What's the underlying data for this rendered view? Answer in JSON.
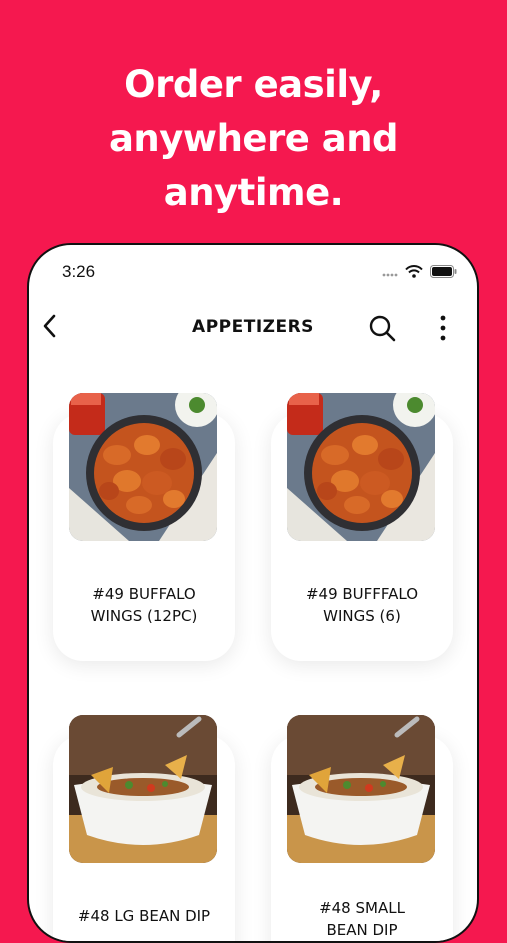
{
  "promo": {
    "headline_lines": [
      "Order easily,",
      "anywhere and",
      "anytime."
    ]
  },
  "status_bar": {
    "time": "3:26"
  },
  "nav": {
    "title": "APPETIZERS"
  },
  "items": [
    {
      "name": "#49 BUFFALO WINGS (12PC)",
      "line1": "#49 BUFFALO",
      "line2": "WINGS (12PC)"
    },
    {
      "name": "#49 BUFFFALO WINGS (6)",
      "line1": "#49 BUFFFALO",
      "line2": "WINGS (6)"
    },
    {
      "name": "#48 LG BEAN DIP",
      "line1": "#48 LG BEAN DIP",
      "line2": ""
    },
    {
      "name": "#48 SMALL BEAN DIP",
      "line1": "#48 SMALL",
      "line2": "BEAN DIP"
    }
  ],
  "colors": {
    "background": "#f5184f",
    "card": "#ffffff",
    "text": "#111111"
  }
}
